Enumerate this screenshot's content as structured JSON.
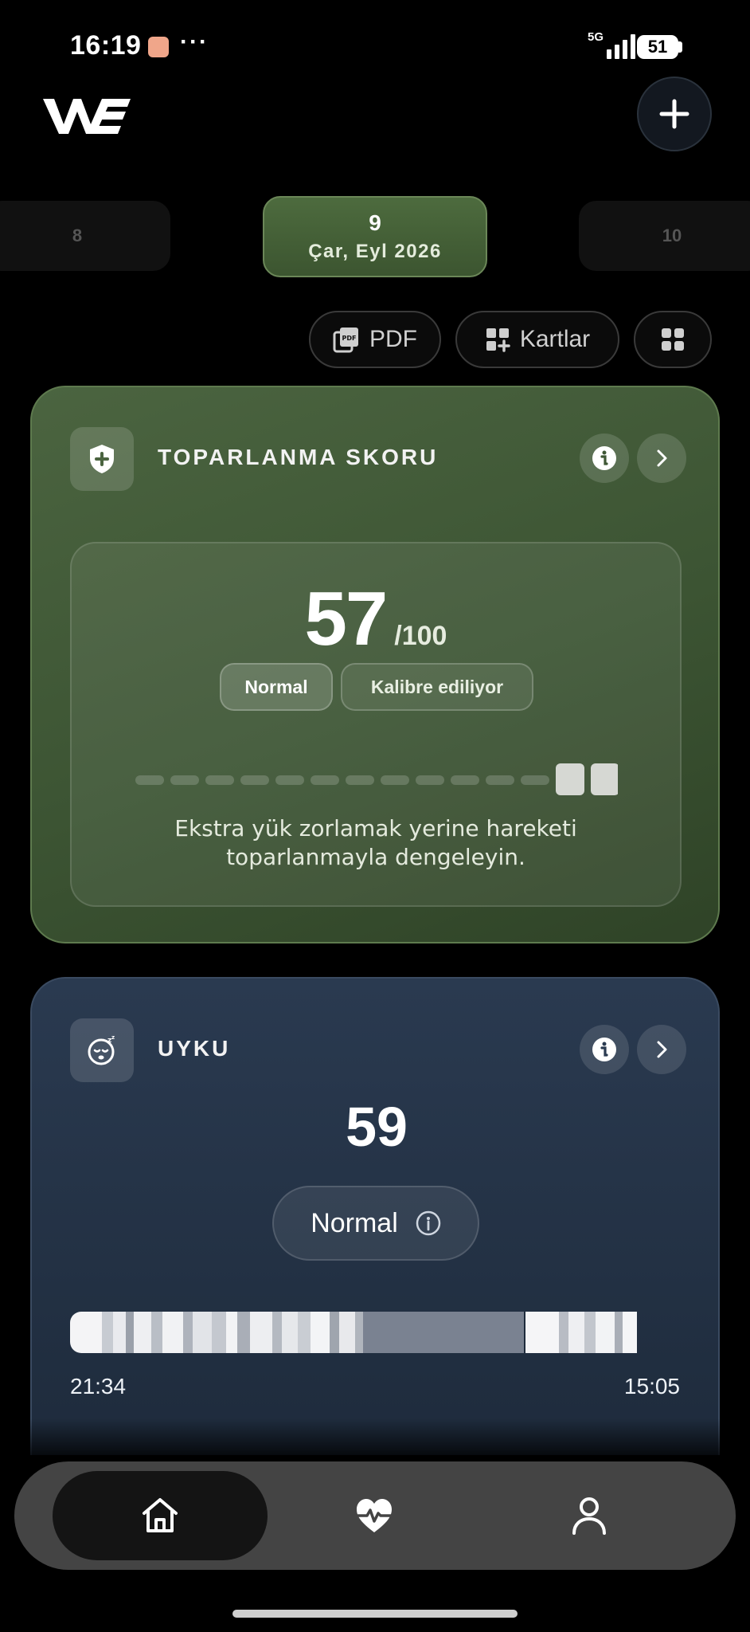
{
  "status_bar": {
    "time": "16:19",
    "more": "···",
    "network": "5G",
    "battery": "51"
  },
  "header": {
    "logo_text": "WE",
    "add_icon": "plus-icon"
  },
  "date_selector": {
    "previous": "8",
    "current_day": "9",
    "current_label": "Çar, Eyl 2026",
    "next": "10"
  },
  "actions": {
    "pdf_label": "PDF",
    "cards_label": "Kartlar",
    "grid_icon": "grid-icon"
  },
  "recovery": {
    "title": "TOPARLANMA SKORU",
    "score": "57",
    "max": "/100",
    "status": "Normal",
    "calibration": "Kalibre ediliyor",
    "scale_level": 0.57,
    "message": "Ekstra yük zorlamak yerine hareketi toparlanmayla dengeleyin.",
    "accent": "#4b6440"
  },
  "sleep": {
    "title": "UYKU",
    "score": "59",
    "status": "Normal",
    "start_time": "21:34",
    "end_time": "15:05",
    "accent": "#2a3a50"
  },
  "nav": {
    "home": "home-icon",
    "health": "heart-pulse-icon",
    "profile": "profile-icon"
  }
}
